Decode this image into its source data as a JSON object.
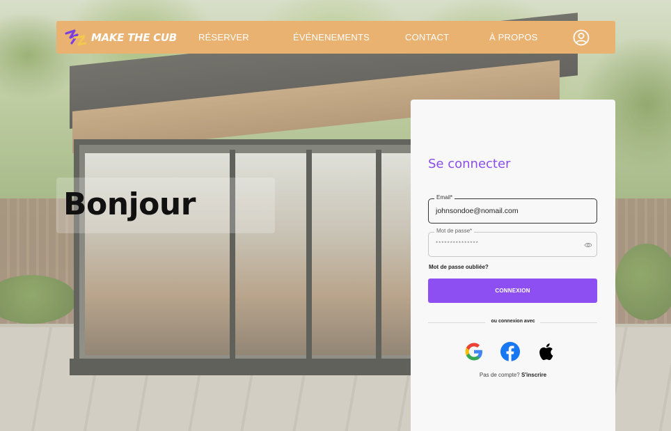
{
  "brand": {
    "name": "MAKE THE CUB"
  },
  "nav": {
    "items": [
      {
        "label": "RÉSERVER"
      },
      {
        "label": "ÉVÉNENEMENTS"
      },
      {
        "label": "CONTACT"
      },
      {
        "label": "À PROPOS"
      }
    ],
    "account_icon": "user-circle-icon"
  },
  "hero": {
    "greeting": "Bonjour"
  },
  "login": {
    "title": "Se connecter",
    "email": {
      "label": "Email*",
      "value": "johnsondoe@nomail.com"
    },
    "password": {
      "label": "Mot de passe*",
      "value": "***************",
      "toggle_icon": "eye-icon"
    },
    "forgot_label": "Mot de passe oubliée?",
    "submit_label": "CONNEXION",
    "divider_label": "ou connexion avec",
    "social": [
      "google-icon",
      "facebook-icon",
      "apple-icon"
    ],
    "signup_prompt": "Pas de compte?",
    "signup_link": "S'inscrire"
  },
  "colors": {
    "navbar": "#e9b271",
    "accent": "#8d4ff2",
    "title": "#8a4dea",
    "card": "#f8f8f9"
  }
}
